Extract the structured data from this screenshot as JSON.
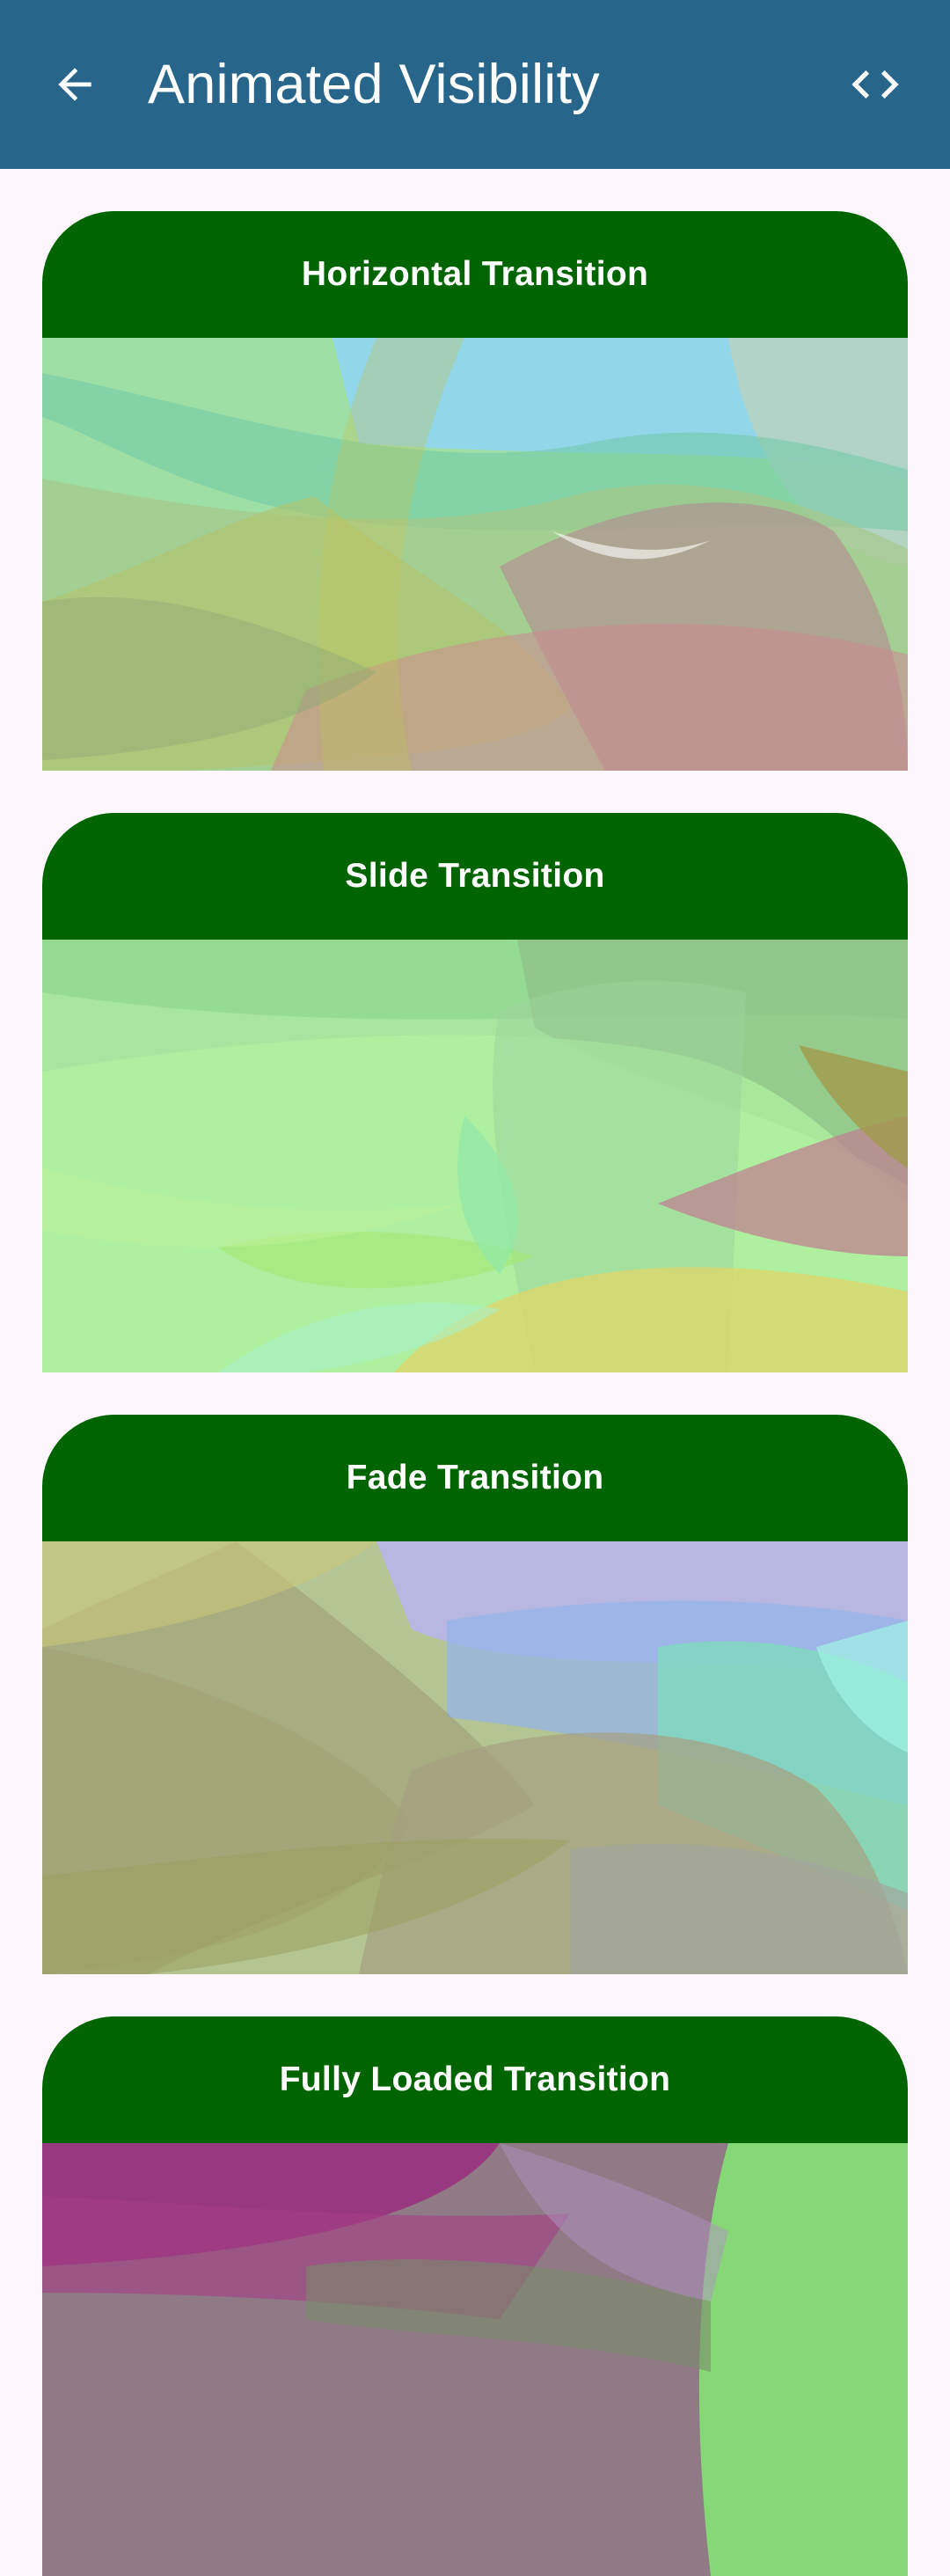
{
  "app_bar": {
    "title": "Animated Visibility",
    "back_icon": "arrow-back-icon",
    "code_icon": "code-brackets-icon",
    "background": "#27668a"
  },
  "cards": [
    {
      "title": "Horizontal Transition"
    },
    {
      "title": "Slide Transition"
    },
    {
      "title": "Fade Transition"
    },
    {
      "title": "Fully Loaded Transition"
    }
  ],
  "colors": {
    "card_header": "#006400",
    "page_background": "#fdf7fd"
  }
}
